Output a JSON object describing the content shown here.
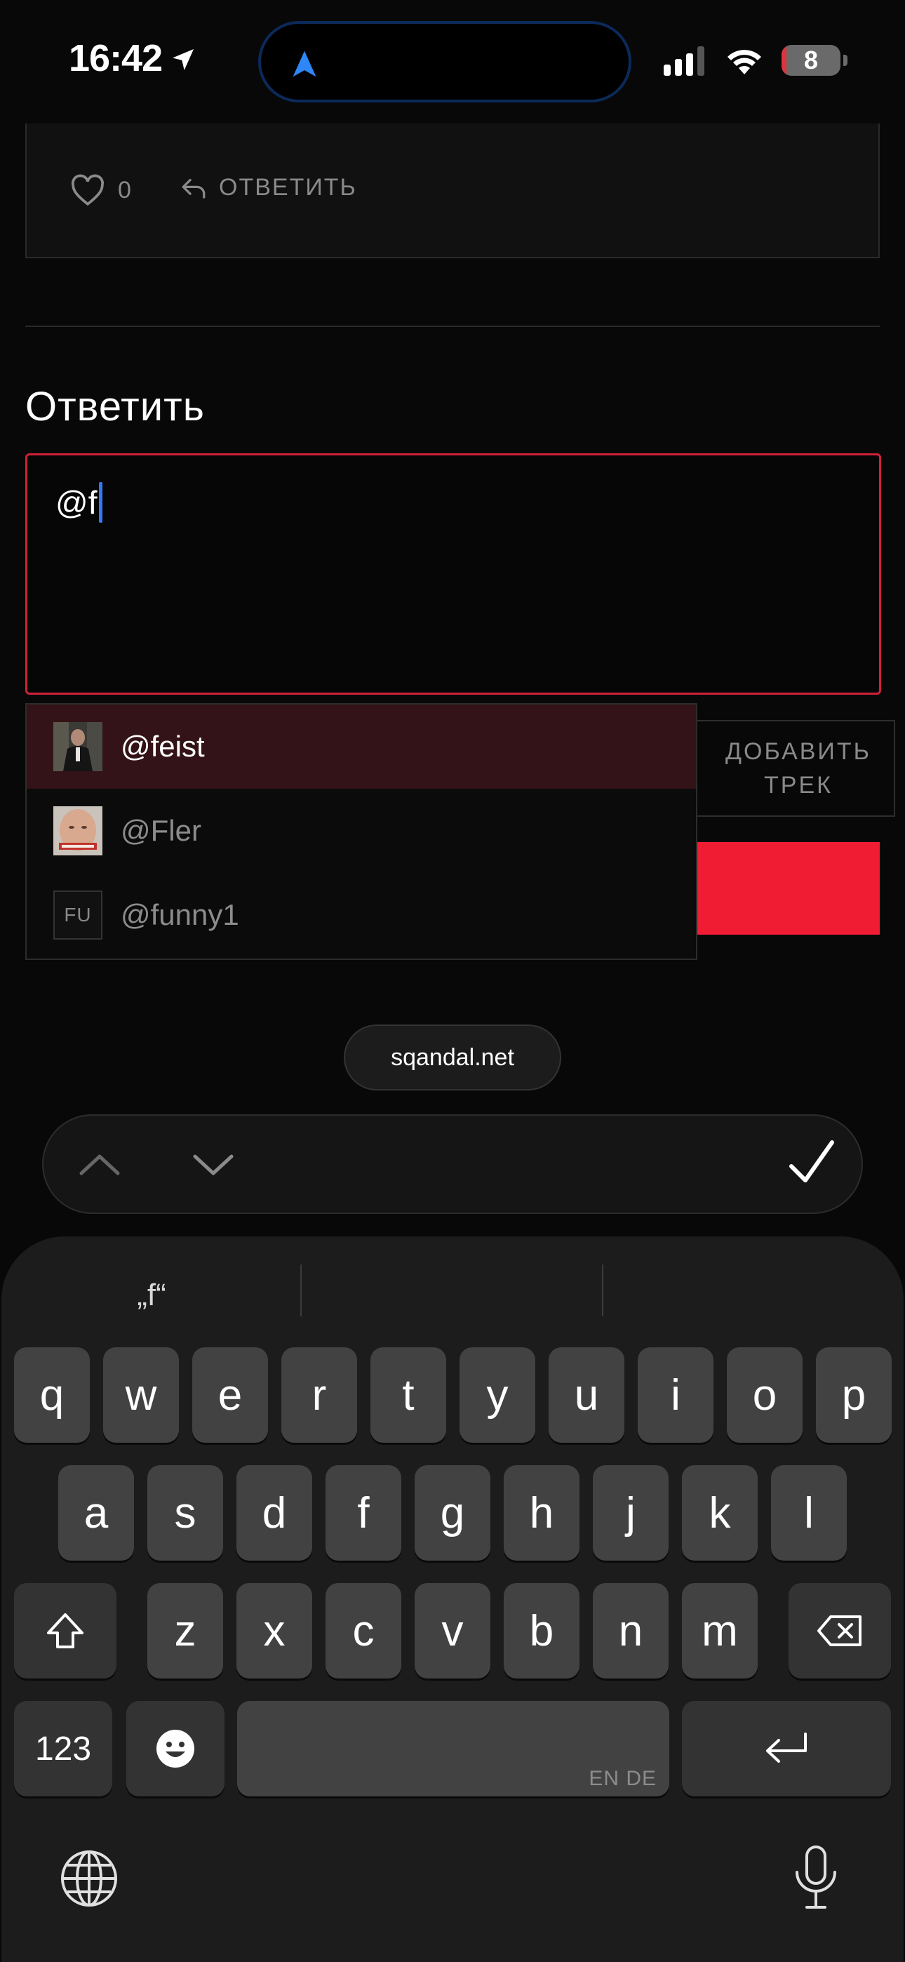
{
  "status_bar": {
    "time": "16:42",
    "battery_level": "8",
    "battery_fraction": 0.08
  },
  "comment": {
    "like_count": "0",
    "reply_label": "ОТВЕТИТЬ"
  },
  "reply_form": {
    "title": "Ответить",
    "input_value": "@f",
    "add_track_label": "ДОБАВИТЬ\nТРЕК"
  },
  "mentions": [
    {
      "handle": "@feist",
      "avatar": "photo",
      "selected": true
    },
    {
      "handle": "@Fler",
      "avatar": "photo",
      "selected": false
    },
    {
      "handle": "@funny1",
      "avatar": "initials",
      "initials": "FU",
      "selected": false
    }
  ],
  "browser": {
    "url": "sqandal.net"
  },
  "keyboard": {
    "suggestions": [
      "„f“",
      "",
      ""
    ],
    "row1": [
      "q",
      "w",
      "e",
      "r",
      "t",
      "y",
      "u",
      "i",
      "o",
      "p"
    ],
    "row2": [
      "a",
      "s",
      "d",
      "f",
      "g",
      "h",
      "j",
      "k",
      "l"
    ],
    "row3": [
      "z",
      "x",
      "c",
      "v",
      "b",
      "n",
      "m"
    ],
    "numbers_label": "123",
    "space_languages": "EN DE"
  },
  "colors": {
    "accent": "#f01c34",
    "input_border": "#d0213a",
    "caret": "#3478f6",
    "selected_row": "#331317"
  }
}
